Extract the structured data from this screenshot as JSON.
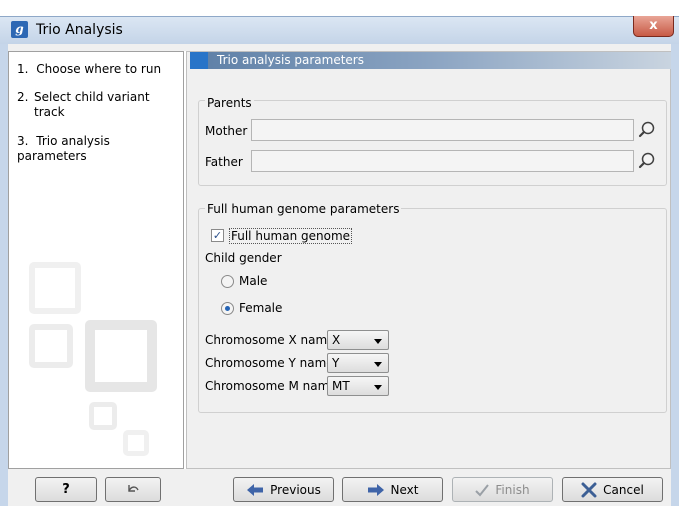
{
  "window": {
    "title": "Trio Analysis",
    "app_icon_letter": "g",
    "close_glyph": "x"
  },
  "steps": [
    {
      "number": "1.",
      "label": "Choose where to run"
    },
    {
      "number": "2.",
      "label": "Select child variant track"
    },
    {
      "number": "3.",
      "label": "Trio analysis parameters"
    }
  ],
  "header": {
    "title": "Trio analysis parameters"
  },
  "parents": {
    "title": "Parents",
    "mother_label": "Mother",
    "mother_value": "",
    "father_label": "Father",
    "father_value": ""
  },
  "genome": {
    "title": "Full human genome parameters",
    "full_genome_label": "Full human genome",
    "full_genome_checked": true,
    "child_gender_label": "Child gender",
    "male_label": "Male",
    "female_label": "Female",
    "selected_gender": "Female",
    "chrX_label": "Chromosome X name",
    "chrX_value": "X",
    "chrY_label": "Chromosome Y name",
    "chrY_value": "Y",
    "chrM_label": "Chromosome M name",
    "chrM_value": "MT"
  },
  "footer": {
    "help_label": "?",
    "previous_label": "Previous",
    "next_label": "Next",
    "finish_label": "Finish",
    "cancel_label": "Cancel"
  },
  "icons": {
    "app": "app-logo-icon",
    "close": "close-icon",
    "browse": "magnifier-browse-icon",
    "reset": "reset-arrow-icon",
    "previous": "arrow-left-icon",
    "next": "arrow-right-icon",
    "finish": "checkmark-icon",
    "cancel": "x-cancel-icon"
  },
  "colors": {
    "header_accent": "#2874c8",
    "radio_selected": "#2463b5",
    "cancel_x": "#3c5f95"
  }
}
